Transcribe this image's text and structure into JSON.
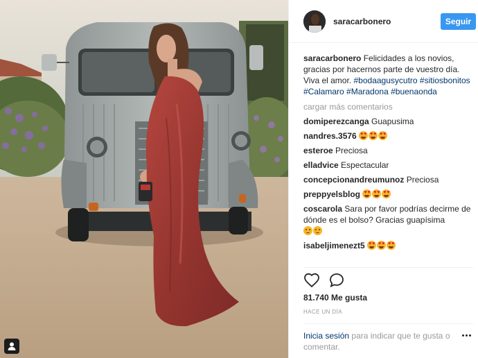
{
  "post": {
    "username": "saracarbonero",
    "follow_label": "Seguir",
    "caption_user": "saracarbonero",
    "caption_text": "Felicidades a los novios, gracias por hacernos parte de vuestro día. Viva el amor.",
    "hashtags": [
      "#bodaagusycutro",
      "#sitiosbonitos",
      "#Calamaro",
      "#Maradona",
      "#buenaonda"
    ],
    "load_more": "cargar más comentarios",
    "comments": [
      {
        "user": "domiperezcanga",
        "text": "Guapusima",
        "emoji": []
      },
      {
        "user": "nandres.3576",
        "text": "",
        "emoji": [
          "heart-eyes",
          "heart-eyes",
          "heart-eyes"
        ]
      },
      {
        "user": "esteroe",
        "text": "Preciosa",
        "emoji": []
      },
      {
        "user": "elladvice",
        "text": "Espectacular",
        "emoji": []
      },
      {
        "user": "concepcionandreumunoz",
        "text": "Preciosa",
        "emoji": []
      },
      {
        "user": "preppyelsblog",
        "text": "",
        "emoji": [
          "heart-eyes",
          "heart-eyes",
          "heart-eyes"
        ]
      },
      {
        "user": "coscarola",
        "text": "Sara por favor podrías decirme de dónde es el bolso? Gracias guapísima",
        "emoji": [
          "blush",
          "blush"
        ]
      },
      {
        "user": "isabeljimenezt5",
        "text": "",
        "emoji": [
          "heart-eyes",
          "heart-eyes",
          "heart-eyes"
        ]
      }
    ],
    "actions": [
      "heart-icon",
      "comment-icon"
    ],
    "likes": "81.740 Me gusta",
    "time": "HACE UN DÍA",
    "login_link": "Inicia sesión",
    "login_text": "para indicar que te gusta o comentar."
  },
  "colors": {
    "accent": "#3897f0",
    "link": "#003569",
    "muted": "#999999",
    "text": "#262626"
  }
}
